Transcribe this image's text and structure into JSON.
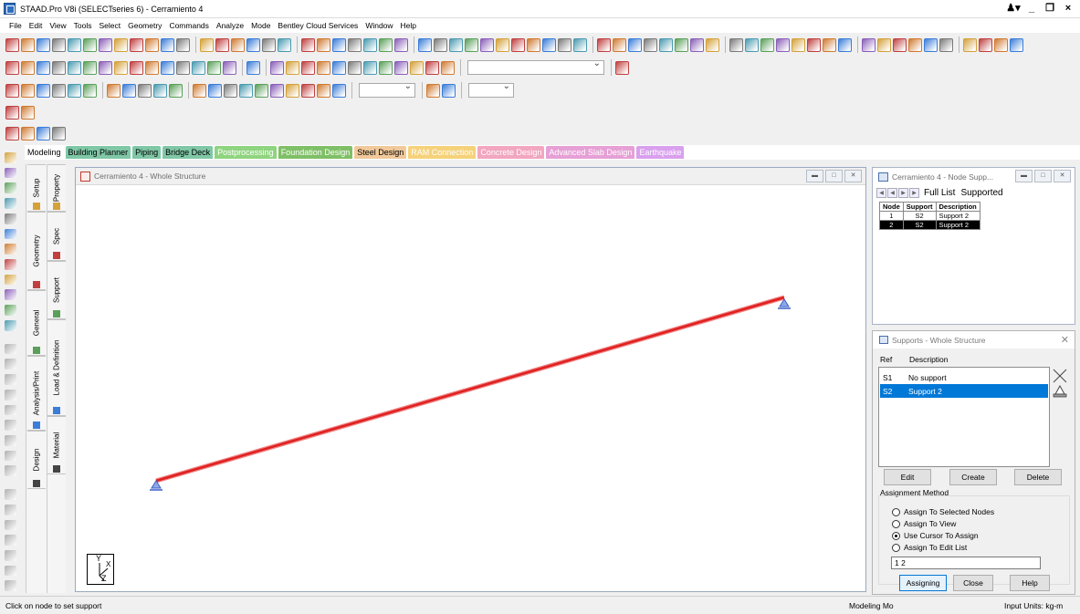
{
  "window": {
    "title": "STAAD.Pro V8i (SELECTseries 6) - Cerramiento 4"
  },
  "menu": [
    "File",
    "Edit",
    "View",
    "Tools",
    "Select",
    "Geometry",
    "Commands",
    "Analyze",
    "Mode",
    "Bentley Cloud Services",
    "Window",
    "Help"
  ],
  "mode_tabs": [
    {
      "label": "Modeling",
      "bg": "#ffffff",
      "fg": "#000000"
    },
    {
      "label": "Building Planner",
      "bg": "#7fc7a6",
      "fg": "#000000"
    },
    {
      "label": "Piping",
      "bg": "#7fc7a6",
      "fg": "#000000"
    },
    {
      "label": "Bridge Deck",
      "bg": "#7fc7a6",
      "fg": "#000000"
    },
    {
      "label": "Postprocessing",
      "bg": "#8fd47f",
      "fg": "#ffffff"
    },
    {
      "label": "Foundation Design",
      "bg": "#7fbf66",
      "fg": "#ffffff"
    },
    {
      "label": "Steel Design",
      "bg": "#f1c99a",
      "fg": "#000000"
    },
    {
      "label": "RAM Connection",
      "bg": "#f5d27a",
      "fg": "#ffffff"
    },
    {
      "label": "Concrete Design",
      "bg": "#f2a6c0",
      "fg": "#ffffff"
    },
    {
      "label": "Advanced Slab Design",
      "bg": "#e6a0d6",
      "fg": "#ffffff"
    },
    {
      "label": "Earthquake",
      "bg": "#d9a0ee",
      "fg": "#ffffff"
    }
  ],
  "side_tabs": {
    "outer": [
      "Setup",
      "Geometry",
      "General",
      "Analysis/Print",
      "Design"
    ],
    "inner": [
      "Property",
      "Spec",
      "Support",
      "Load & Definition",
      "Material"
    ]
  },
  "view_window": {
    "title": "Cerramiento 4 - Whole Structure"
  },
  "axis": {
    "y": "Y",
    "x": "X",
    "z": "Z"
  },
  "node_panel": {
    "title": "Cerramiento 4 - Node Supp...",
    "tabs": [
      "Full List",
      "Supported"
    ],
    "headers": [
      "Node",
      "Support",
      "Description"
    ],
    "rows": [
      {
        "node": "1",
        "support": "S2",
        "desc": "Support 2",
        "selected": false
      },
      {
        "node": "2",
        "support": "S2",
        "desc": "Support 2",
        "selected": true
      }
    ]
  },
  "supports_panel": {
    "title": "Supports - Whole Structure",
    "col_ref": "Ref",
    "col_desc": "Description",
    "items": [
      {
        "ref": "S1",
        "desc": "No support",
        "selected": false
      },
      {
        "ref": "S2",
        "desc": "Support 2",
        "selected": true
      }
    ],
    "buttons": {
      "edit": "Edit",
      "create": "Create",
      "delete": "Delete",
      "assigning": "Assigning",
      "close": "Close",
      "help": "Help"
    },
    "assignment_label": "Assignment Method",
    "options": [
      {
        "label": "Assign To Selected Nodes",
        "checked": false
      },
      {
        "label": "Assign To View",
        "checked": false
      },
      {
        "label": "Use Cursor To Assign",
        "checked": true
      },
      {
        "label": "Assign To Edit List",
        "checked": false
      }
    ],
    "edit_list_value": "1 2"
  },
  "status": {
    "hint": "Click on node to set support",
    "mode": "Modeling Mo",
    "units": "Input Units:  kg-m"
  },
  "colors": {
    "member": "#e02020",
    "support": "#3a5fc8",
    "selection": "#0078d7"
  }
}
